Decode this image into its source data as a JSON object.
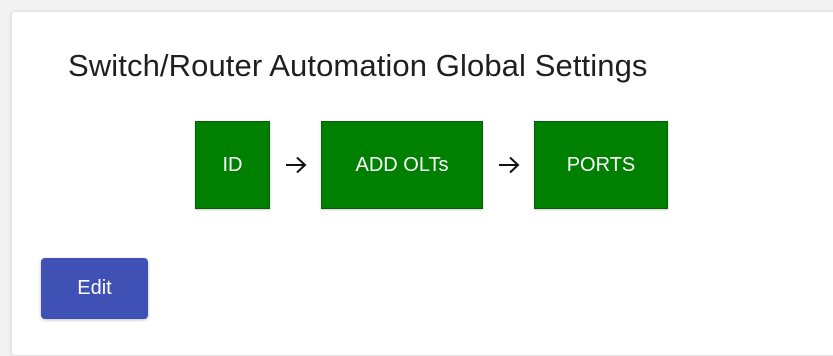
{
  "settings_card": {
    "title": "Switch/Router Automation Global Settings",
    "workflow_steps": [
      {
        "label": "ID",
        "color": "#008000"
      },
      {
        "label": "ADD OLTs",
        "color": "#008000"
      },
      {
        "label": "PORTS",
        "color": "#008000"
      }
    ],
    "step_separator_icon": "arrow-right-icon",
    "edit_button": {
      "label": "Edit",
      "color": "#3f51b5"
    }
  }
}
